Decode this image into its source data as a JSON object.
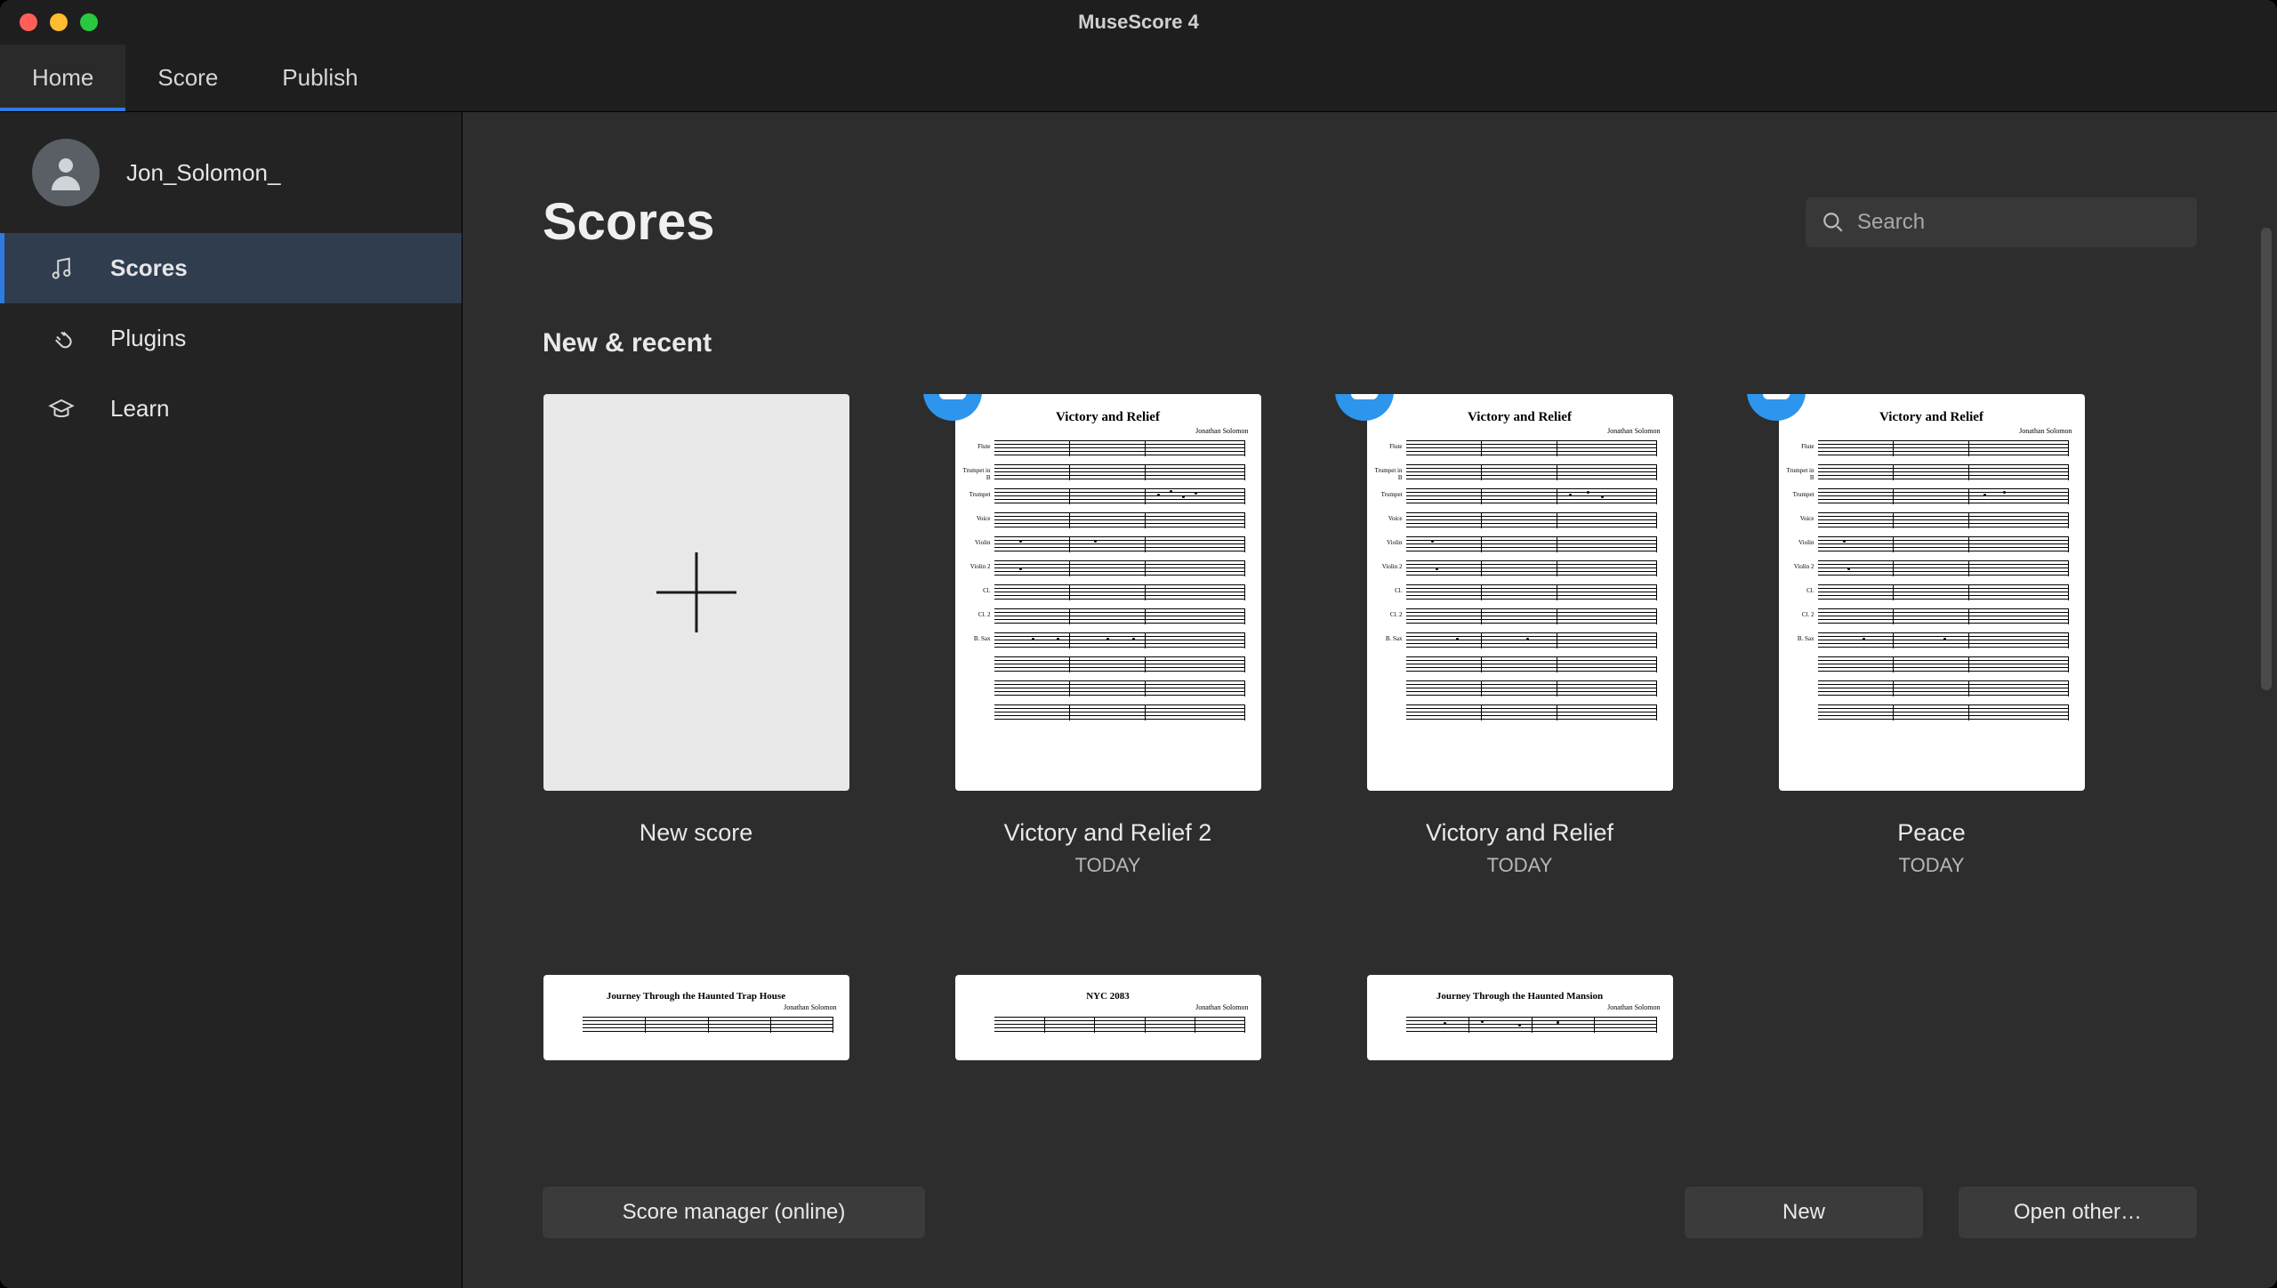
{
  "window_title": "MuseScore 4",
  "tabs": [
    {
      "label": "Home",
      "active": true
    },
    {
      "label": "Score",
      "active": false
    },
    {
      "label": "Publish",
      "active": false
    }
  ],
  "sidebar": {
    "user_name": "Jon_Solomon_",
    "items": [
      {
        "id": "scores",
        "label": "Scores",
        "icon": "music-note-icon",
        "active": true
      },
      {
        "id": "plugins",
        "label": "Plugins",
        "icon": "plug-icon",
        "active": false
      },
      {
        "id": "learn",
        "label": "Learn",
        "icon": "graduation-icon",
        "active": false
      }
    ]
  },
  "page": {
    "title": "Scores",
    "search_placeholder": "Search",
    "section_title": "New & recent"
  },
  "scores_row1": [
    {
      "type": "new",
      "title": "New score",
      "date": ""
    },
    {
      "type": "score",
      "title": "Victory and Relief 2",
      "date": "TODAY",
      "cloud": true,
      "sheet_title": "Victory and Relief",
      "sheet_author": "Jonathan Solomon"
    },
    {
      "type": "score",
      "title": "Victory and Relief",
      "date": "TODAY",
      "cloud": true,
      "sheet_title": "Victory and Relief",
      "sheet_author": "Jonathan Solomon"
    },
    {
      "type": "score",
      "title": "Peace",
      "date": "TODAY",
      "cloud": true,
      "sheet_title": "Victory and Relief",
      "sheet_author": "Jonathan Solomon"
    }
  ],
  "scores_row2": [
    {
      "sheet_title": "Journey Through the Haunted Trap House",
      "sheet_author": "Jonathan Solomon"
    },
    {
      "sheet_title": "NYC 2083",
      "sheet_author": "Jonathan Solomon"
    },
    {
      "sheet_title": "Journey Through the Haunted Mansion",
      "sheet_author": "Jonathan Solomon"
    }
  ],
  "buttons": {
    "score_manager": "Score manager (online)",
    "new": "New",
    "open_other": "Open other…"
  },
  "instruments": [
    "Flute",
    "Trumpet in B",
    "Trumpet",
    "Voice",
    "Violin",
    "Violin 2",
    "Cl.",
    "Cl. 2",
    "B. Sax"
  ],
  "colors": {
    "accent": "#2e7ce0"
  }
}
